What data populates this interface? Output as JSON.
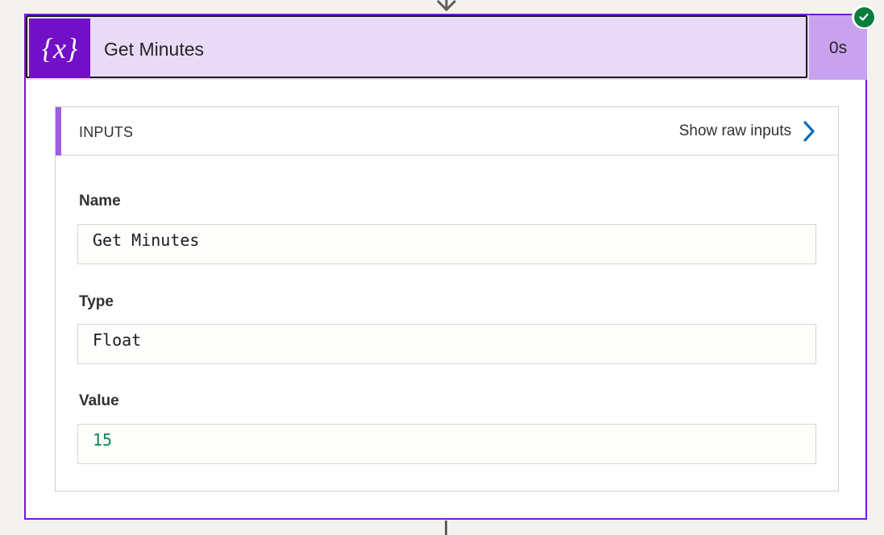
{
  "action": {
    "title": "Get Minutes",
    "duration": "0s",
    "icon": "variable-icon",
    "icon_text": "{x}",
    "status": "succeeded"
  },
  "inputs": {
    "section_title": "INPUTS",
    "show_raw_label": "Show raw inputs",
    "fields": [
      {
        "label": "Name",
        "value": "Get Minutes"
      },
      {
        "label": "Type",
        "value": "Float"
      },
      {
        "label": "Value",
        "value": "15"
      }
    ]
  },
  "colors": {
    "accent": "#7719d2",
    "header_bg": "#e9dbf7",
    "duration_bg": "#c9a2ef",
    "success": "#0a7d3c",
    "link_chevron": "#0f6cbd",
    "number_value": "#098658"
  }
}
